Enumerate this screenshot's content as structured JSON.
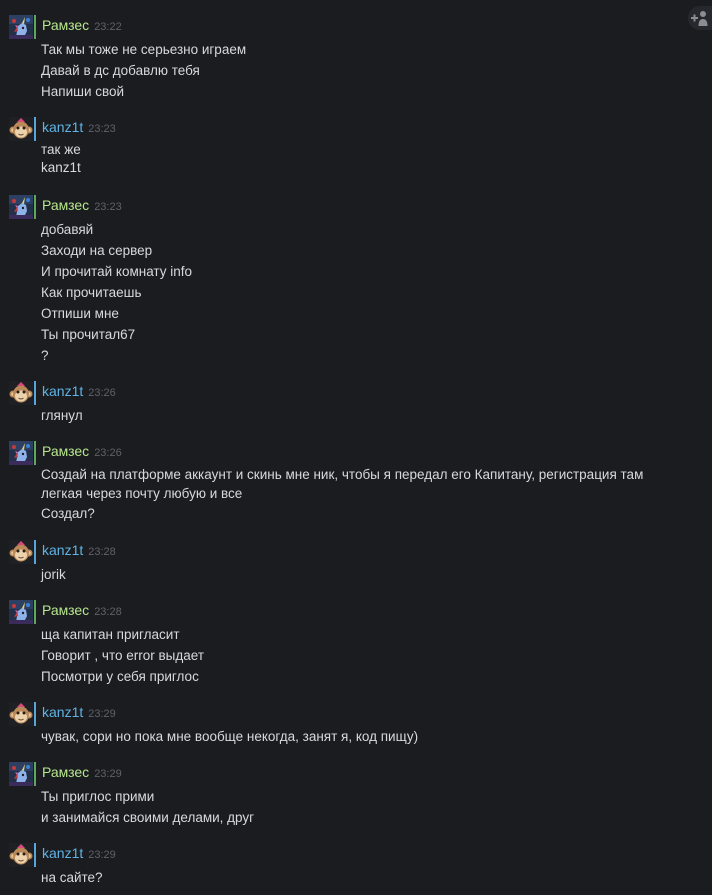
{
  "groups": [
    {
      "author": "Рамзес",
      "time": "23:22",
      "messages": [
        "Так мы тоже не серьезно играем",
        "Давай в дс добавлю тебя",
        "Напиши свой"
      ]
    },
    {
      "author": "kanz1t",
      "time": "23:23",
      "messages": [
        "так же",
        "kanz1t"
      ]
    },
    {
      "author": "Рамзес",
      "time": "23:23",
      "messages": [
        "добавяй",
        "Заходи на сервер",
        "И прочитай комнату info",
        "Как прочитаешь",
        "Отпиши мне",
        "Ты прочитал67",
        "?"
      ]
    },
    {
      "author": "kanz1t",
      "time": "23:26",
      "messages": [
        "глянул"
      ]
    },
    {
      "author": "Рамзес",
      "time": "23:26",
      "messages": [
        "Создай на платформе аккаунт и скинь мне ник, чтобы я передал его Капитану, регистрация там",
        "легкая через почту любую и все",
        "Создал?"
      ]
    },
    {
      "author": "kanz1t",
      "time": "23:28",
      "messages": [
        "jorik"
      ]
    },
    {
      "author": "Рамзес",
      "time": "23:28",
      "messages": [
        "ща капитан пригласит",
        "Говорит , что error выдает",
        "Посмотри у себя приглос"
      ]
    },
    {
      "author": "kanz1t",
      "time": "23:29",
      "messages": [
        "чувак, сори но пока мне вообще некогда, занят я, код пищу)"
      ]
    },
    {
      "author": "Рамзес",
      "time": "23:29",
      "messages": [
        "Ты приглос прими",
        "и занимайся своими делами, друг"
      ]
    },
    {
      "author": "kanz1t",
      "time": "23:29",
      "messages": [
        "на сайте?"
      ]
    }
  ],
  "icons": {
    "add_friend": "add-friend-icon",
    "ramses_avatar": "unicorn-avatar",
    "kanz_avatar": "monkey-avatar"
  },
  "colors": {
    "background": "#1b1c20",
    "ramses_name": "#b7e68c",
    "kanz_name": "#5fb3e4",
    "message_text": "#d7d9dc",
    "timestamp": "#5f6168",
    "status_online": "#5fa85a",
    "status_ingame": "#57a6d9"
  }
}
